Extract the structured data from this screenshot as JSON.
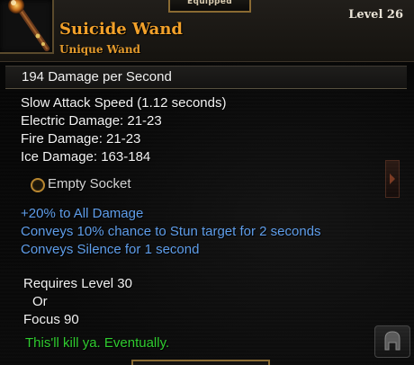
{
  "header": {
    "equipped_label": "Equipped",
    "item_name": "Suicide Wand",
    "item_type": "Unique Wand",
    "level": "Level 26",
    "icon": "wand-icon"
  },
  "dps": {
    "text": "194  Damage per Second"
  },
  "stats": [
    "Slow Attack Speed (1.12 seconds)",
    "Electric Damage: 21-23",
    "Fire Damage: 21-23",
    "Ice Damage: 163-184"
  ],
  "socket": {
    "label": "Empty Socket",
    "icon": "socket-icon"
  },
  "affixes": [
    "+20% to All Damage",
    "Conveys 10% chance to Stun target for 2 seconds",
    "Conveys Silence for 1 second"
  ],
  "requirements": {
    "line1": "Requires Level 30",
    "line2": "Or",
    "line3": "Focus 90"
  },
  "flavor": "This'll kill ya. Eventually.",
  "colors": {
    "name": "#f2a12a",
    "affix": "#5e9dea",
    "flavor": "#2ecc2e",
    "frame_gold": "#8a6a32"
  }
}
